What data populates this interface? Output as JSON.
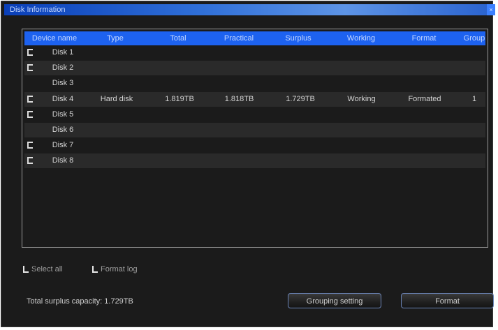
{
  "window": {
    "title": "Disk Information",
    "close_glyph": "×"
  },
  "table": {
    "columns": [
      "Device name",
      "Type",
      "Total",
      "Practical",
      "Surplus",
      "Working",
      "Format",
      "Group"
    ],
    "rows": [
      {
        "checkbox": true,
        "name": "Disk 1",
        "type": "",
        "total": "",
        "practical": "",
        "surplus": "",
        "working": "",
        "format": "",
        "group": ""
      },
      {
        "checkbox": true,
        "name": "Disk 2",
        "type": "",
        "total": "",
        "practical": "",
        "surplus": "",
        "working": "",
        "format": "",
        "group": ""
      },
      {
        "checkbox": false,
        "name": "Disk 3",
        "type": "",
        "total": "",
        "practical": "",
        "surplus": "",
        "working": "",
        "format": "",
        "group": ""
      },
      {
        "checkbox": true,
        "name": "Disk 4",
        "type": "Hard disk",
        "total": "1.819TB",
        "practical": "1.818TB",
        "surplus": "1.729TB",
        "working": "Working",
        "format": "Formated",
        "group": "1"
      },
      {
        "checkbox": true,
        "name": "Disk 5",
        "type": "",
        "total": "",
        "practical": "",
        "surplus": "",
        "working": "",
        "format": "",
        "group": ""
      },
      {
        "checkbox": false,
        "name": "Disk 6",
        "type": "",
        "total": "",
        "practical": "",
        "surplus": "",
        "working": "",
        "format": "",
        "group": ""
      },
      {
        "checkbox": true,
        "name": "Disk 7",
        "type": "",
        "total": "",
        "practical": "",
        "surplus": "",
        "working": "",
        "format": "",
        "group": ""
      },
      {
        "checkbox": true,
        "name": "Disk 8",
        "type": "",
        "total": "",
        "practical": "",
        "surplus": "",
        "working": "",
        "format": "",
        "group": ""
      }
    ]
  },
  "options": {
    "select_all": "Select all",
    "format_log": "Format log"
  },
  "summary": "Total surplus capacity: 1.729TB",
  "buttons": {
    "grouping": "Grouping setting",
    "format": "Format"
  },
  "colors": {
    "header_blue": "#1d62f0",
    "window_bg": "#1b1b1b",
    "alt_row": "#2a2a2a"
  }
}
